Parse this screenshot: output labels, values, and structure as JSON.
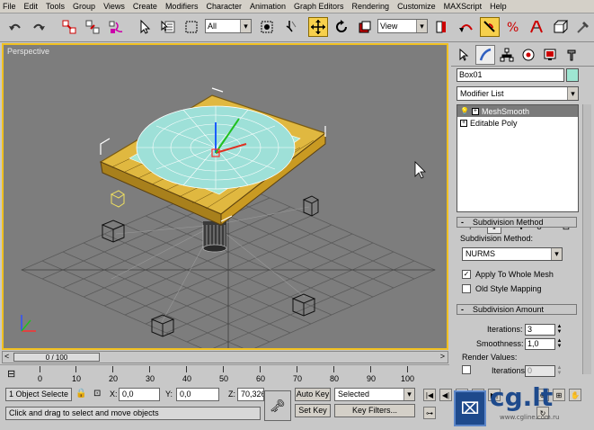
{
  "menu": [
    "File",
    "Edit",
    "Tools",
    "Group",
    "Views",
    "Create",
    "Modifiers",
    "Character",
    "Animation",
    "Graph Editors",
    "Rendering",
    "Customize",
    "MAXScript",
    "Help"
  ],
  "toolbar": {
    "selection_filter": "All",
    "ref_coord": "View",
    "icons": [
      "undo-icon",
      "redo-icon",
      "link-icon",
      "unlink-icon",
      "bind-space-warp-icon",
      "select-icon",
      "select-by-name-icon",
      "rect-region-icon",
      "window-crossing-icon",
      "select-move-icon",
      "select-rotate-icon",
      "select-scale-icon",
      "pivot-icon",
      "mirror-icon",
      "align-icon",
      "snap-icon",
      "angle-snap-icon",
      "percent-snap-icon"
    ]
  },
  "viewport": {
    "label": "Perspective"
  },
  "command_panel": {
    "object_name": "Box01",
    "object_color": "#9ee6d2",
    "modifier_list": "Modifier List",
    "stack": [
      {
        "label": "MeshSmooth",
        "selected": true
      },
      {
        "label": "Editable Poly",
        "selected": false
      }
    ],
    "subdivision_method": {
      "title": "Subdivision Method",
      "label": "Subdivision Method:",
      "value": "NURMS",
      "apply_whole_mesh": "Apply To Whole Mesh",
      "old_style": "Old Style Mapping"
    },
    "subdivision_amount": {
      "title": "Subdivision Amount",
      "iterations_label": "Iterations:",
      "iterations": "3",
      "smoothness_label": "Smoothness:",
      "smoothness": "1,0",
      "render_values": "Render Values:",
      "render_iterations_label": "Iterations:",
      "render_iterations": "0"
    }
  },
  "timeline": {
    "frame": "0 / 100",
    "ticks": [
      "0",
      "10",
      "20",
      "30",
      "40",
      "50",
      "60",
      "70",
      "80",
      "90",
      "100"
    ]
  },
  "status": {
    "selection": "1 Object Selecte",
    "x_label": "X:",
    "x_value": "0,0",
    "y_label": "Y:",
    "y_value": "0,0",
    "z_label": "Z:",
    "z_value": "70,326",
    "auto_key": "Auto Key",
    "set_key": "Set Key",
    "key_mode": "Selected",
    "key_filters": "Key Filters...",
    "prompt": "Click and drag to select and move objects"
  },
  "watermark": {
    "text": "cg.lt",
    "url": "www.cgline.com.ru"
  }
}
